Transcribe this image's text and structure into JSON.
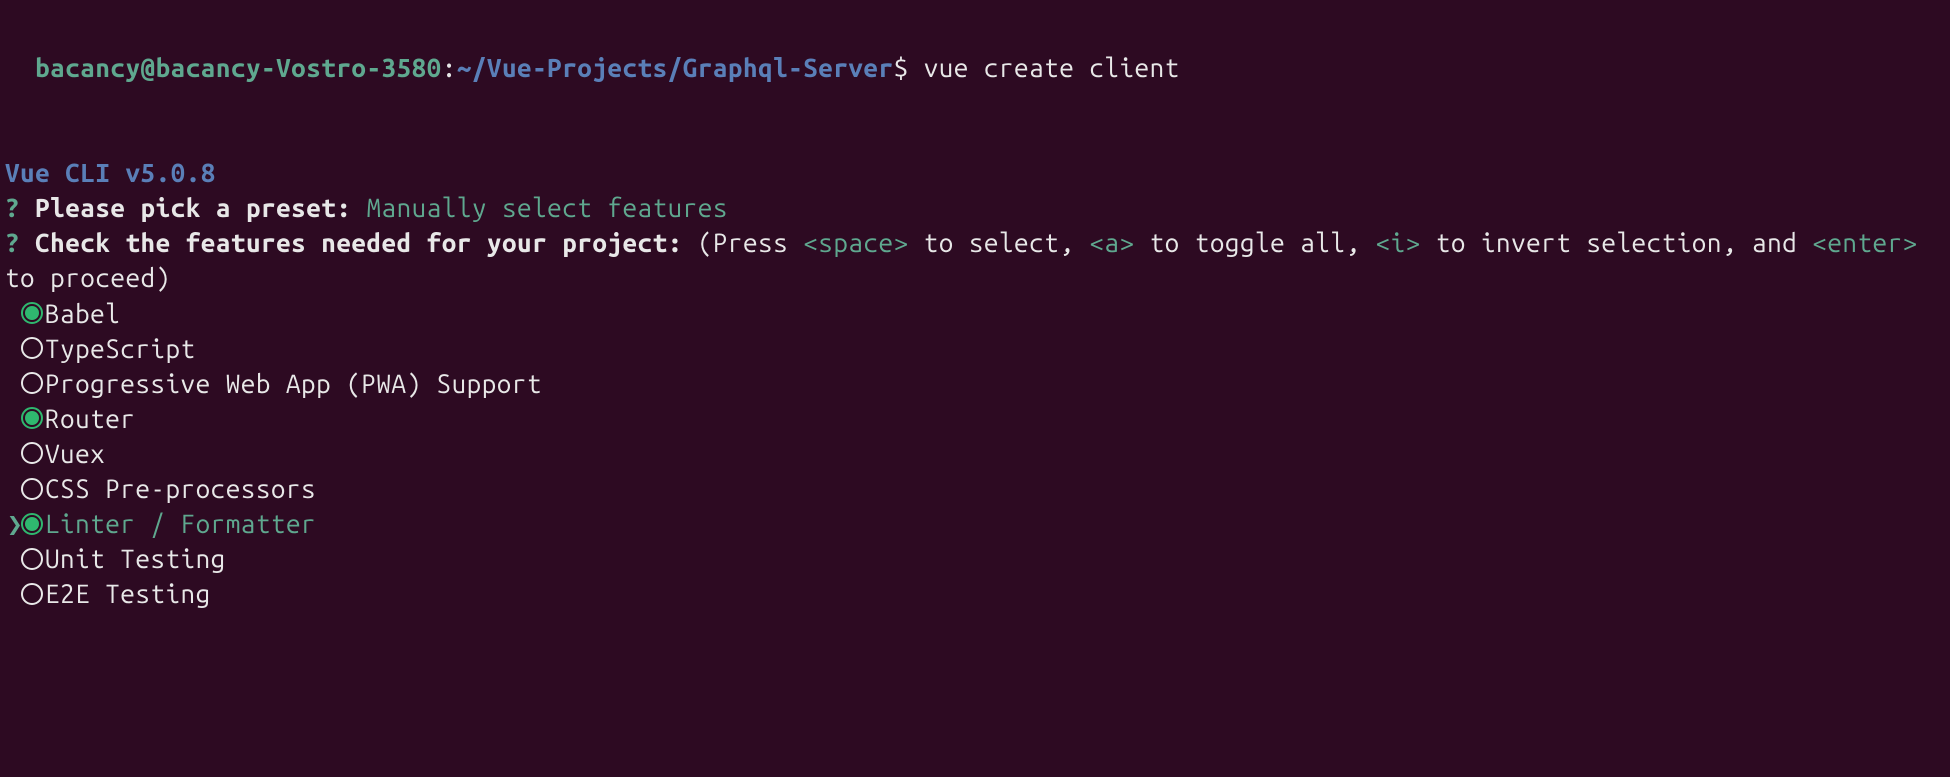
{
  "prompt": {
    "user_host": "bacancy@bacancy-Vostro-3580",
    "colon": ":",
    "path": "~/Vue-Projects/Graphql-Server",
    "dollar": "$",
    "command": "vue create client"
  },
  "cli": {
    "version": "Vue CLI v5.0.8"
  },
  "questions": {
    "q1_mark": "?",
    "q1_text": "Please pick a preset:",
    "q1_answer": "Manually select features",
    "q2_mark": "?",
    "q2_text": "Check the features needed for your project:",
    "q2_hint_1": "(Press ",
    "q2_key_1": "<space>",
    "q2_hint_2": " to select, ",
    "q2_key_2": "<a>",
    "q2_hint_3": " to toggle all, ",
    "q2_key_3": "<i>",
    "q2_hint_4": " to invert selection, and ",
    "q2_key_4": "<enter>",
    "q2_hint_5": " to proceed)"
  },
  "features": [
    {
      "label": "Babel",
      "selected": true,
      "active": false
    },
    {
      "label": "TypeScript",
      "selected": false,
      "active": false
    },
    {
      "label": "Progressive Web App (PWA) Support",
      "selected": false,
      "active": false
    },
    {
      "label": "Router",
      "selected": true,
      "active": false
    },
    {
      "label": "Vuex",
      "selected": false,
      "active": false
    },
    {
      "label": "CSS Pre-processors",
      "selected": false,
      "active": false
    },
    {
      "label": "Linter / Formatter",
      "selected": true,
      "active": true
    },
    {
      "label": "Unit Testing",
      "selected": false,
      "active": false
    },
    {
      "label": "E2E Testing",
      "selected": false,
      "active": false
    }
  ],
  "cursor": "❯"
}
